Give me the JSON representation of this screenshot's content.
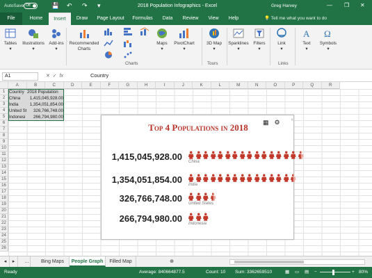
{
  "titlebar": {
    "autosave": "AutoSave",
    "toggle": "Off",
    "title": "2018 Population Infographics - Excel",
    "user": "Greg Harvey",
    "min": "—",
    "restore": "❐",
    "close": "✕"
  },
  "tabs": [
    "File",
    "Home",
    "Insert",
    "Draw",
    "Page Layout",
    "Formulas",
    "Data",
    "Review",
    "View",
    "Help"
  ],
  "active_tab": "Insert",
  "tell_me": "Tell me what you want to do",
  "ribbon": {
    "buttons": [
      "Tables",
      "Illustrations",
      "Add-ins",
      "Recommended Charts",
      "Maps",
      "PivotChart",
      "3D Map",
      "Sparklines",
      "Filters",
      "Link",
      "Text",
      "Symbols"
    ],
    "groups": [
      "Charts",
      "Tours",
      "Links"
    ]
  },
  "formula": {
    "namebox": "A1",
    "fx": "fx",
    "content": "Country"
  },
  "columns": [
    "A",
    "B",
    "C",
    "D",
    "E",
    "F",
    "G",
    "H",
    "I",
    "J",
    "K",
    "L",
    "M",
    "N",
    "O",
    "P",
    "Q",
    "R"
  ],
  "rows": [
    "1",
    "2",
    "3",
    "4",
    "5",
    "6",
    "7",
    "8",
    "9",
    "10",
    "11",
    "12",
    "13",
    "14",
    "15",
    "16",
    "17",
    "18",
    "19",
    "20",
    "21",
    "22",
    "23",
    "24",
    "25",
    "26"
  ],
  "table": {
    "header": [
      "Country",
      "2018 Population"
    ],
    "rows": [
      [
        "China",
        "1,415,045,928.00"
      ],
      [
        "India",
        "1,354,051,854.00"
      ],
      [
        "United St",
        "326,766,748.00"
      ],
      [
        "Indonesi",
        "266,794,980.00"
      ]
    ]
  },
  "chart_data": {
    "type": "bar",
    "title": "Top 4 Populations in 2018",
    "categories": [
      "China",
      "India",
      "United States",
      "Indonesia"
    ],
    "value_labels": [
      "1,415,045,928.00",
      "1,354,051,854.00",
      "326,766,748.00",
      "266,794,980.00"
    ],
    "values": [
      1415045928,
      1354051854,
      326766748,
      266794980
    ],
    "people_icons": [
      15.5,
      14.5,
      3.5,
      3
    ],
    "colors": {
      "person": "#c0392b",
      "person_light": "#e8a79d",
      "title": "#b8342a"
    }
  },
  "sheets": [
    "Bing Maps",
    "People Graph",
    "Filled Map"
  ],
  "active_sheet": "People Graph",
  "status": {
    "ready": "Ready",
    "average": "Average: 840664877.5",
    "count": "Count: 10",
    "sum": "Sum: 3362659510",
    "zoom": "80%"
  }
}
